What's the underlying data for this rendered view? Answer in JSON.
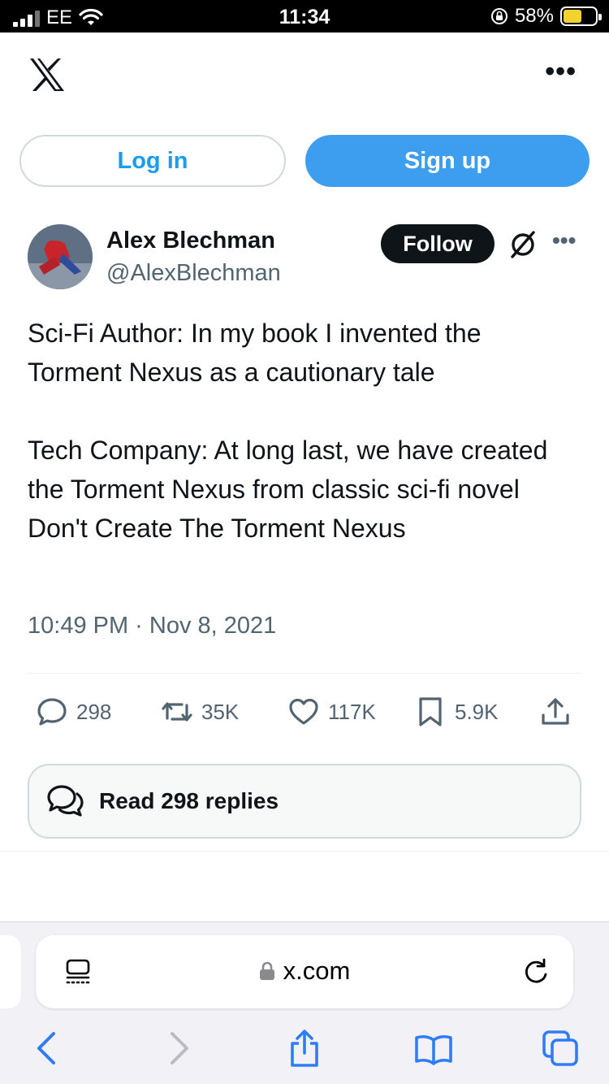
{
  "status_bar": {
    "carrier": "EE",
    "time": "11:34",
    "battery_percent": "58%",
    "battery_level": 0.58
  },
  "header": {
    "logo_icon": "x-logo-icon",
    "more_icon": "more-horizontal-icon"
  },
  "auth": {
    "login_label": "Log in",
    "signup_label": "Sign up"
  },
  "tweet": {
    "author_name": "Alex Blechman",
    "author_handle": "@AlexBlechman",
    "follow_label": "Follow",
    "paragraphs": [
      "Sci-Fi Author: In my book I invented the Torment Nexus as a cautionary tale",
      "Tech Company: At long last, we have created the Torment Nexus from classic sci-fi novel Don't Create The Torment Nexus"
    ],
    "timestamp": "10:49 PM · Nov 8, 2021",
    "stats": {
      "replies": "298",
      "reposts": "35K",
      "likes": "117K",
      "bookmarks": "5.9K"
    },
    "read_replies_label": "Read 298 replies"
  },
  "browser": {
    "url": "x.com"
  },
  "colors": {
    "brand_blue": "#1d9bf0",
    "signup_bg": "#3d9ef0",
    "text_primary": "#0f1419",
    "text_secondary": "#536471",
    "safari_blue": "#2f7cf6"
  }
}
